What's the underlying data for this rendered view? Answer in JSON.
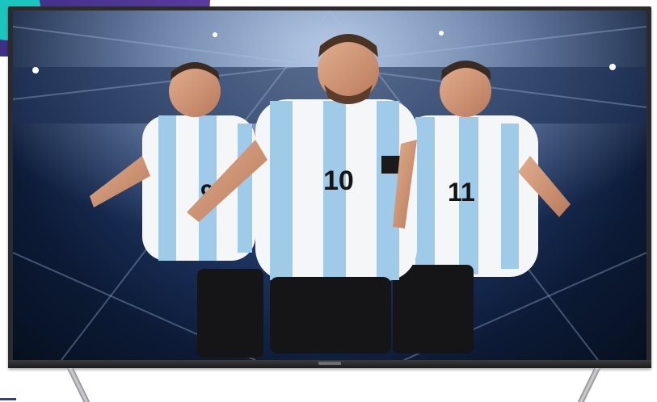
{
  "image": {
    "subject": "",
    "colors": {
      "bezel": "#2b2b2e",
      "sky_center": "#6f8fbd",
      "sky_edge": "#06101f",
      "jersey_blue": "#9fcbe8",
      "jersey_white": "#f4f6f8",
      "shorts": "#151518",
      "badge_purple": "#3b2e84",
      "badge_teal": "#1cc4c0"
    },
    "icons": [
      "gift-box-icon",
      "box-icon"
    ]
  },
  "players": [
    {
      "number": "9"
    },
    {
      "number": "10"
    },
    {
      "number": "11"
    }
  ]
}
